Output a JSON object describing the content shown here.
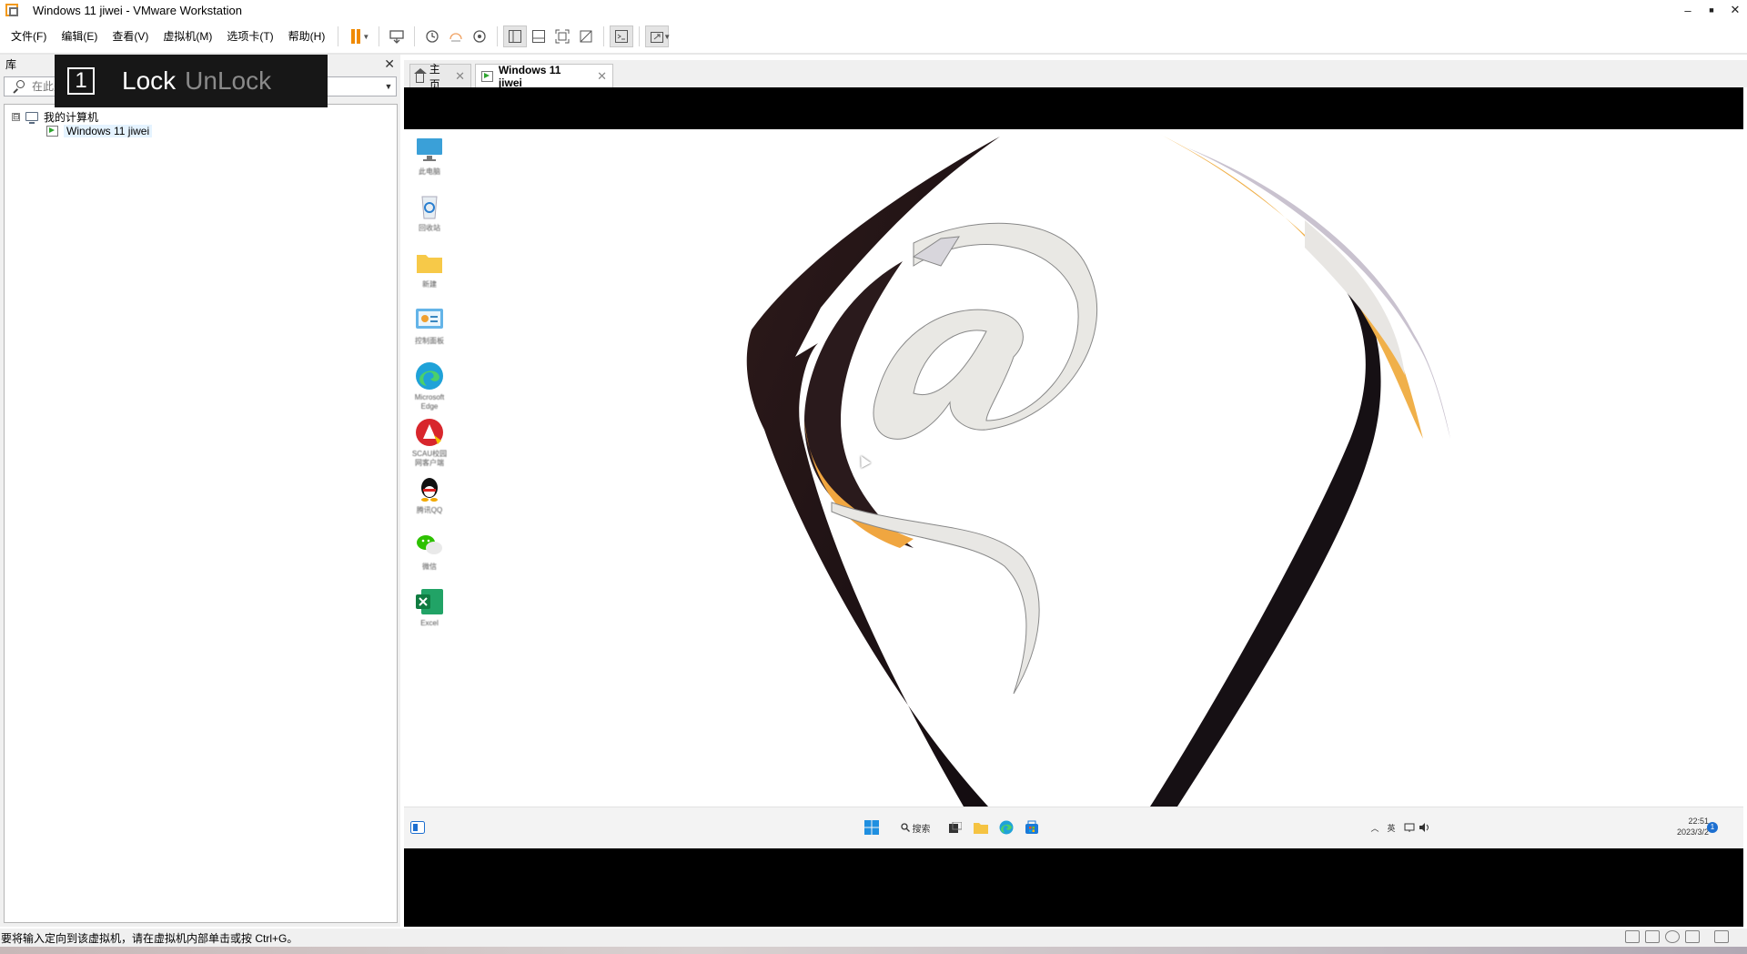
{
  "window": {
    "title": "Windows 11 jiwei - VMware Workstation",
    "controls": {
      "minimize": "–",
      "maximize": "■",
      "close": "✕"
    }
  },
  "menu": {
    "file": "文件(F)",
    "edit": "编辑(E)",
    "view": "查看(V)",
    "vm": "虚拟机(M)",
    "tabs": "选项卡(T)",
    "help": "帮助(H)"
  },
  "toolbar": {
    "icons": [
      "pause-icon",
      "send-ctrl-alt-del-icon",
      "snapshot-icon",
      "revert-snapshot-icon",
      "snapshot-manager-icon",
      "show-library-icon",
      "thumbnail-bar-icon",
      "fullscreen-icon",
      "unity-icon",
      "console-icon",
      "stretch-guest-icon"
    ],
    "accent": "#f08a00"
  },
  "library": {
    "title": "库",
    "close": "✕",
    "search_placeholder": "在此处键入内容进行搜索",
    "tree": {
      "root_label": "我的计算机",
      "expand": "⊟",
      "vm_label": "Windows 11 jiwei"
    }
  },
  "overlay": {
    "number": "1",
    "lock": "Lock",
    "unlock": "UnLock"
  },
  "tabs": [
    {
      "label": "主页",
      "close": "✕",
      "active": false
    },
    {
      "label": "Windows 11 jiwei",
      "close": "✕",
      "active": true
    }
  ],
  "vm": {
    "desktop_icons": [
      {
        "label": "此电脑",
        "icon": "monitor-icon"
      },
      {
        "label": "回收站",
        "icon": "recycle-bin-icon"
      },
      {
        "label": "新建",
        "icon": "folder-icon"
      },
      {
        "label": "控制面板",
        "icon": "control-panel-icon"
      },
      {
        "label": "Microsoft Edge",
        "icon": "edge-icon"
      },
      {
        "label": "SCAU校园网客户端",
        "icon": "campus-client-icon"
      },
      {
        "label": "腾讯QQ",
        "icon": "qq-icon"
      },
      {
        "label": "微信",
        "icon": "wechat-icon"
      },
      {
        "label": "Excel",
        "icon": "excel-icon"
      }
    ],
    "taskbar": {
      "search_label": "搜索",
      "ime": "英",
      "time": "22:51",
      "date": "2023/3/2",
      "notification_count": "1"
    }
  },
  "status": {
    "message": "要将输入定向到该虚拟机，请在虚拟机内部单击或按 Ctrl+G。"
  }
}
